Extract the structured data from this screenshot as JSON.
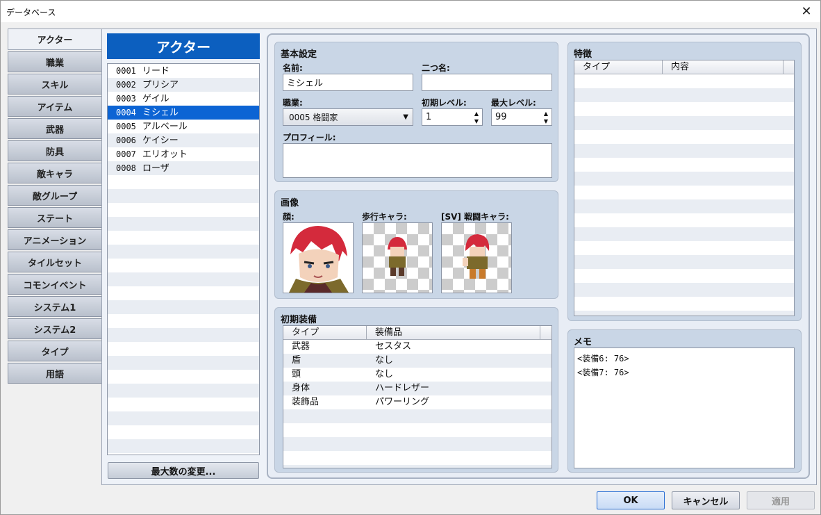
{
  "window": {
    "title": "データベース",
    "close_glyph": "✕"
  },
  "tabs": [
    {
      "label": "アクター",
      "active": true
    },
    {
      "label": "職業"
    },
    {
      "label": "スキル"
    },
    {
      "label": "アイテム"
    },
    {
      "label": "武器"
    },
    {
      "label": "防具"
    },
    {
      "label": "敵キャラ"
    },
    {
      "label": "敵グループ"
    },
    {
      "label": "ステート"
    },
    {
      "label": "アニメーション"
    },
    {
      "label": "タイルセット"
    },
    {
      "label": "コモンイベント"
    },
    {
      "label": "システム1"
    },
    {
      "label": "システム2"
    },
    {
      "label": "タイプ"
    },
    {
      "label": "用語"
    }
  ],
  "list": {
    "header": "アクター",
    "items": [
      {
        "id": "0001",
        "name": "リード"
      },
      {
        "id": "0002",
        "name": "プリシア"
      },
      {
        "id": "0003",
        "name": "ゲイル"
      },
      {
        "id": "0004",
        "name": "ミシェル",
        "selected": true
      },
      {
        "id": "0005",
        "name": "アルベール"
      },
      {
        "id": "0006",
        "name": "ケイシー"
      },
      {
        "id": "0007",
        "name": "エリオット"
      },
      {
        "id": "0008",
        "name": "ローザ"
      }
    ],
    "max_button": "最大数の変更..."
  },
  "basic": {
    "title": "基本設定",
    "name_label": "名前:",
    "name_value": "ミシェル",
    "nickname_label": "二つ名:",
    "nickname_value": "",
    "class_label": "職業:",
    "class_value": "0005 格闘家",
    "initial_level_label": "初期レベル:",
    "initial_level_value": "1",
    "max_level_label": "最大レベル:",
    "max_level_value": "99",
    "profile_label": "プロフィール:",
    "profile_value": ""
  },
  "images": {
    "title": "画像",
    "face_label": "顔:",
    "walk_label": "歩行キャラ:",
    "battler_label": "[SV] 戦闘キャラ:"
  },
  "equipment": {
    "title": "初期装備",
    "columns": [
      "タイプ",
      "装備品"
    ],
    "rows": [
      [
        "武器",
        "セスタス"
      ],
      [
        "盾",
        "なし"
      ],
      [
        "頭",
        "なし"
      ],
      [
        "身体",
        "ハードレザー"
      ],
      [
        "装飾品",
        "パワーリング"
      ]
    ]
  },
  "traits": {
    "title": "特徴",
    "columns": [
      "タイプ",
      "内容"
    ]
  },
  "memo": {
    "title": "メモ",
    "lines": [
      "<装備6: 76>",
      "<装備7: 76>"
    ]
  },
  "buttons": {
    "ok": "OK",
    "cancel": "キャンセル",
    "apply": "適用"
  },
  "colors": {
    "selection": "#0c64d4",
    "list_header": "#0c5fbf",
    "panel": "#c9d6e6"
  }
}
